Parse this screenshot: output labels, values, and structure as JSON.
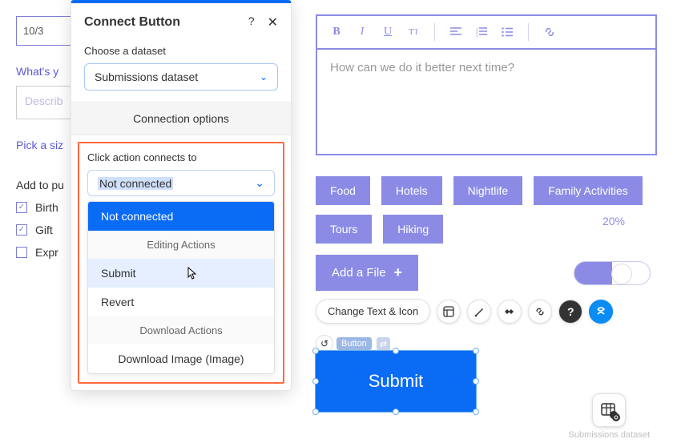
{
  "bg": {
    "date": "10/3",
    "q1": "What's y",
    "describe_ph": "Describ",
    "q2": "Pick a siz",
    "addto_label": "Add to pu",
    "checks": [
      "Birth",
      "Gift",
      "Expr"
    ]
  },
  "panel": {
    "title": "Connect Button",
    "choose_label": "Choose a dataset",
    "dataset_value": "Submissions dataset",
    "connection_options": "Connection options",
    "click_label": "Click action connects to",
    "click_value": "Not connected",
    "dropdown": {
      "selected": "Not connected",
      "group1": "Editing Actions",
      "submit": "Submit",
      "revert": "Revert",
      "group2": "Download Actions",
      "download_image": "Download Image (Image)"
    }
  },
  "editor": {
    "placeholder": "How can we do it better next time?"
  },
  "tags": [
    "Food",
    "Hotels",
    "Nightlife",
    "Family Activities",
    "Tours",
    "Hiking"
  ],
  "percent": "20%",
  "addfile": "Add a File",
  "change_text": "Change Text & Icon",
  "button_badge": "Button",
  "submit_label": "Submit",
  "dataset_widget": "Submissions dataset"
}
